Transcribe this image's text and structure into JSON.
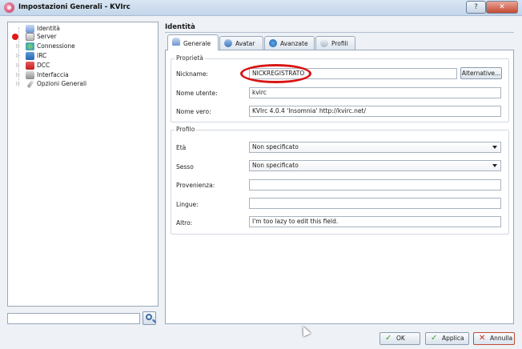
{
  "window": {
    "title": "Impostazioni Generali - KVIrc",
    "help_glyph": "?",
    "close_glyph": "✕"
  },
  "tree": {
    "items": [
      {
        "label": "Identità",
        "icon": "identity-icon"
      },
      {
        "label": "Server",
        "icon": "server-icon"
      },
      {
        "label": "Connessione",
        "icon": "connection-icon"
      },
      {
        "label": "IRC",
        "icon": "irc-icon"
      },
      {
        "label": "DCC",
        "icon": "dcc-icon"
      },
      {
        "label": "Interfaccia",
        "icon": "interface-icon"
      },
      {
        "label": "Opzioni Generali",
        "icon": "options-icon"
      }
    ],
    "search_value": ""
  },
  "section": {
    "title": "Identità"
  },
  "tabs": [
    {
      "label": "Generale",
      "active": true
    },
    {
      "label": "Avatar",
      "active": false
    },
    {
      "label": "Avanzate",
      "active": false
    },
    {
      "label": "Profili",
      "active": false
    }
  ],
  "properties": {
    "group_title": "Proprietà",
    "nickname_label": "Nickname:",
    "nickname_value": "NICKREGISTRATO",
    "alternative_button": "Alternative...",
    "username_label": "Nome utente:",
    "username_value": "kvirc",
    "realname_label": "Nome vero:",
    "realname_value": "KVIrc 4.0.4 'Insomnia' http://kvirc.net/"
  },
  "profile": {
    "group_title": "Profilo",
    "age_label": "Età",
    "age_value": "Non specificato",
    "sex_label": "Sesso",
    "sex_value": "Non specificato",
    "origin_label": "Provenienza:",
    "origin_value": "",
    "languages_label": "Lingue:",
    "languages_value": "",
    "other_label": "Altro:",
    "other_value": "I'm too lazy to edit this field."
  },
  "buttons": {
    "ok": "OK",
    "apply": "Applica",
    "cancel": "Annulla"
  },
  "colors": {
    "accent_red": "#d81414",
    "check_green": "#3a9a2a",
    "cancel_red": "#d02a1a"
  }
}
